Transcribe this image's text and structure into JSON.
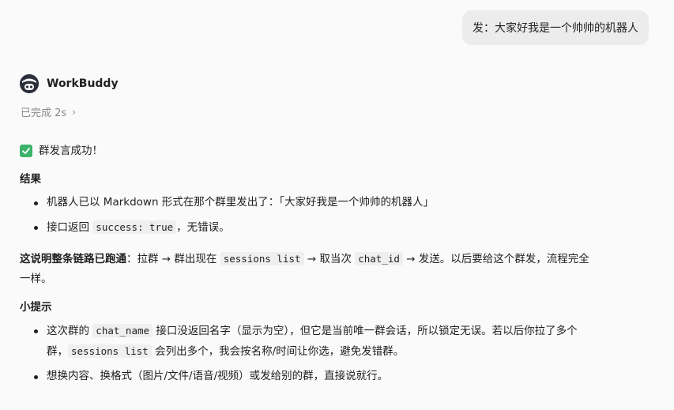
{
  "user_message": {
    "text": "发：大家好我是一个帅帅的机器人"
  },
  "assistant": {
    "name": "WorkBuddy",
    "status": "已完成 2s",
    "status_chevron": "›"
  },
  "reply": {
    "success": "群发言成功！",
    "result_heading": "结果",
    "result_items": [
      {
        "text": "机器人已以 Markdown 形式在那个群里发出了：「大家好我是一个帅帅的机器人」"
      },
      {
        "pre": "接口返回 ",
        "code": "success: true",
        "post": "，无错误。"
      }
    ],
    "chain": {
      "lead": "这说明整条链路已跑通",
      "p1": "：拉群 → 群出现在 ",
      "code1": "sessions list",
      "p2": " → 取当次 ",
      "code2": "chat_id",
      "p3": " → 发送。以后要给这个群发，流程完全",
      "p4": "一样。"
    },
    "tips_heading": "小提示",
    "tips": {
      "item1": {
        "p1": "这次群的 ",
        "code1": "chat_name",
        "p2": " 接口没返回名字（显示为空），但它是当前唯一群会话，所以锁定无误。若以后你拉了多个",
        "p3": "群，",
        "code2": "sessions list",
        "p4": " 会列出多个，我会按名称/时间让你选，避免发错群。"
      },
      "item2": {
        "text": "想换内容、换格式（图片/文件/语音/视频）或发给别的群，直接说就行。"
      }
    }
  },
  "colors": {
    "background": "#fafafa",
    "bubble": "#ececec",
    "success_green": "#3bb36b",
    "muted": "#8a8a8a"
  },
  "icons": {
    "avatar": "workbuddy-avatar-icon",
    "chevron": "chevron-right-icon",
    "check": "check-mark-icon"
  }
}
